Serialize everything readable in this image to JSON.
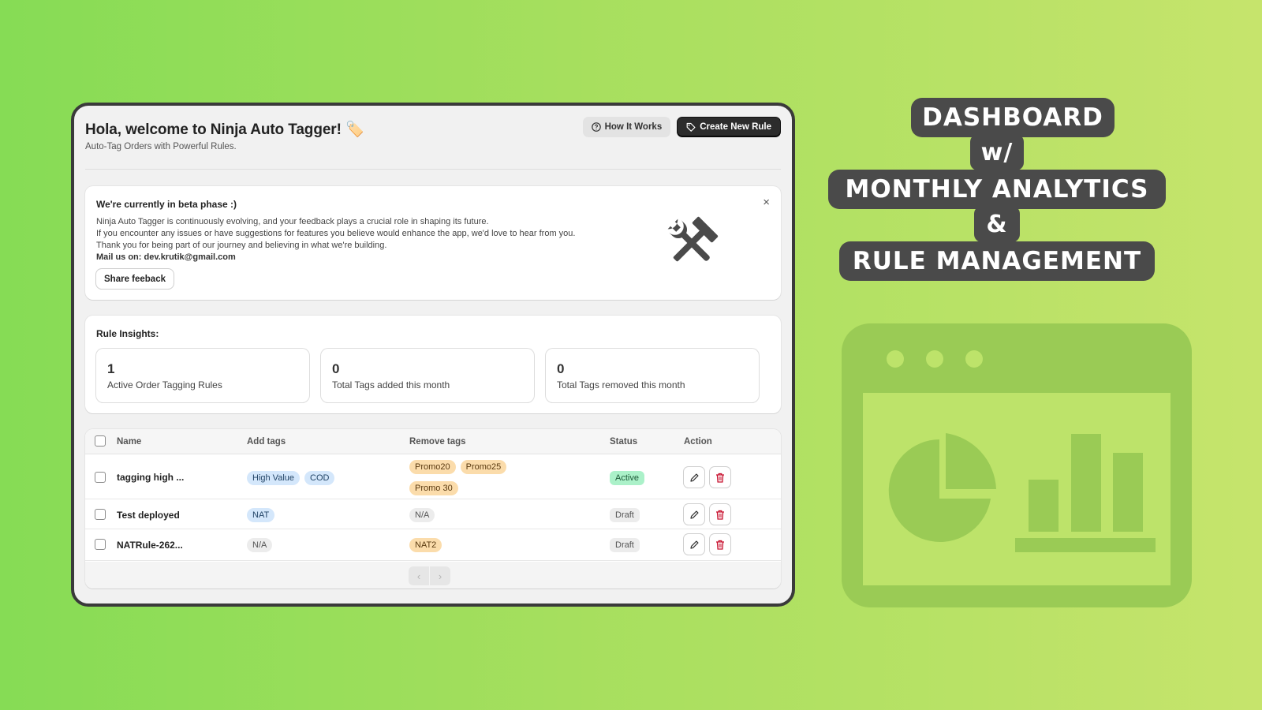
{
  "app": {
    "title": "Hola, welcome to Ninja Auto Tagger! 🏷️",
    "subtitle": "Auto-Tag Orders with Powerful Rules.",
    "how_it_works_label": "How It Works",
    "create_rule_label": "Create New Rule"
  },
  "beta": {
    "title": "We're currently in beta phase :)",
    "lines": [
      "Ninja Auto Tagger is continuously evolving, and your feedback plays a crucial role in shaping its future.",
      "If you encounter any issues or have suggestions for features you believe would enhance the app, we'd love to hear from you.",
      "Thank you for being part of our journey and believing in what we're building."
    ],
    "mail": "Mail us on: dev.krutik@gmail.com",
    "share_label": "Share feeback",
    "close_glyph": "×"
  },
  "insights": {
    "title": "Rule Insights:",
    "metrics": [
      {
        "value": "1",
        "label": "Active Order Tagging Rules"
      },
      {
        "value": "0",
        "label": "Total Tags added this month"
      },
      {
        "value": "0",
        "label": "Total Tags removed this month"
      }
    ]
  },
  "table": {
    "headers": {
      "name": "Name",
      "add_tags": "Add tags",
      "remove_tags": "Remove tags",
      "status": "Status",
      "action": "Action"
    },
    "rows": [
      {
        "name": "tagging high ...",
        "add_tags": [
          "High Value",
          "COD"
        ],
        "remove_tags": [
          "Promo20",
          "Promo25",
          "Promo 30"
        ],
        "status": "Active"
      },
      {
        "name": "Test deployed",
        "add_tags": [
          "NAT"
        ],
        "remove_tags": [
          "N/A"
        ],
        "status": "Draft"
      },
      {
        "name": "NATRule-262...",
        "add_tags": [
          "N/A"
        ],
        "remove_tags": [
          "NAT2"
        ],
        "status": "Draft"
      }
    ],
    "pager": {
      "prev": "‹",
      "next": "›"
    }
  },
  "headline": {
    "line1": "DASHBOARD",
    "line2": "w/",
    "line3": "MONTHLY ANALYTICS",
    "line4": "&",
    "line5": "RULE MANAGEMENT"
  },
  "colors": {
    "chip_bg": "#4a4a4a",
    "illustration": "#9acb55",
    "active_status": "#abf1c9",
    "tag_blue": "#d4e7fb",
    "tag_orange": "#fbdcab"
  }
}
